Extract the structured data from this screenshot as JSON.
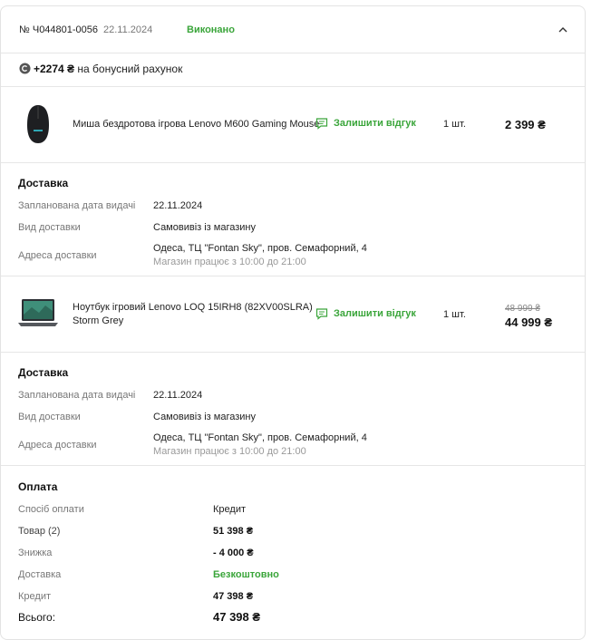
{
  "order": {
    "number": "№ Ч044801-0056",
    "date": "22.11.2024",
    "status": "Виконано",
    "bonus_amount": "+2274 ₴",
    "bonus_text": "на бонусний рахунок"
  },
  "items": [
    {
      "name": "Миша бездротова ігрова Lenovo M600 Gaming Mouse",
      "review_label": "Залишити відгук",
      "qty": "1 шт.",
      "price": "2 399 ₴"
    },
    {
      "name_line1": "Ноутбук ігровий Lenovo LOQ 15IRH8 (82XV00SLRA)",
      "name_line2": "Storm Grey",
      "review_label": "Залишити відгук",
      "qty": "1 шт.",
      "old_price": "48 999 ₴",
      "price": "44 999 ₴"
    }
  ],
  "deliveries": [
    {
      "title": "Доставка",
      "date_label": "Запланована дата видачі",
      "date_value": "22.11.2024",
      "type_label": "Вид доставки",
      "type_value": "Самовивіз із магазину",
      "address_label": "Адреса доставки",
      "address_value": "Одеса, ТЦ \"Fontan Sky\", пров. Семафорний, 4",
      "hours": "Магазин працює з 10:00 до 21:00"
    },
    {
      "title": "Доставка",
      "date_label": "Запланована дата видачі",
      "date_value": "22.11.2024",
      "type_label": "Вид доставки",
      "type_value": "Самовивіз із магазину",
      "address_label": "Адреса доставки",
      "address_value": "Одеса, ТЦ \"Fontan Sky\", пров. Семафорний, 4",
      "hours": "Магазин працює з 10:00 до 21:00"
    }
  ],
  "payment": {
    "title": "Оплата",
    "method_label": "Спосіб оплати",
    "method_value": "Кредит",
    "goods_label": "Товар (2)",
    "goods_value": "51 398 ₴",
    "discount_label": "Знижка",
    "discount_value": "- 4 000 ₴",
    "delivery_label": "Доставка",
    "delivery_value": "Безкоштовно",
    "credit_label": "Кредит",
    "credit_value": "47 398 ₴",
    "total_label": "Всього:",
    "total_value": "47 398 ₴"
  },
  "colors": {
    "accent_green": "#3aa53a",
    "text": "#222222",
    "muted": "#777777",
    "divider": "#e6e6e6"
  },
  "icons": [
    "chevron-up-icon",
    "bonus-coin-icon",
    "review-chat-icon"
  ]
}
